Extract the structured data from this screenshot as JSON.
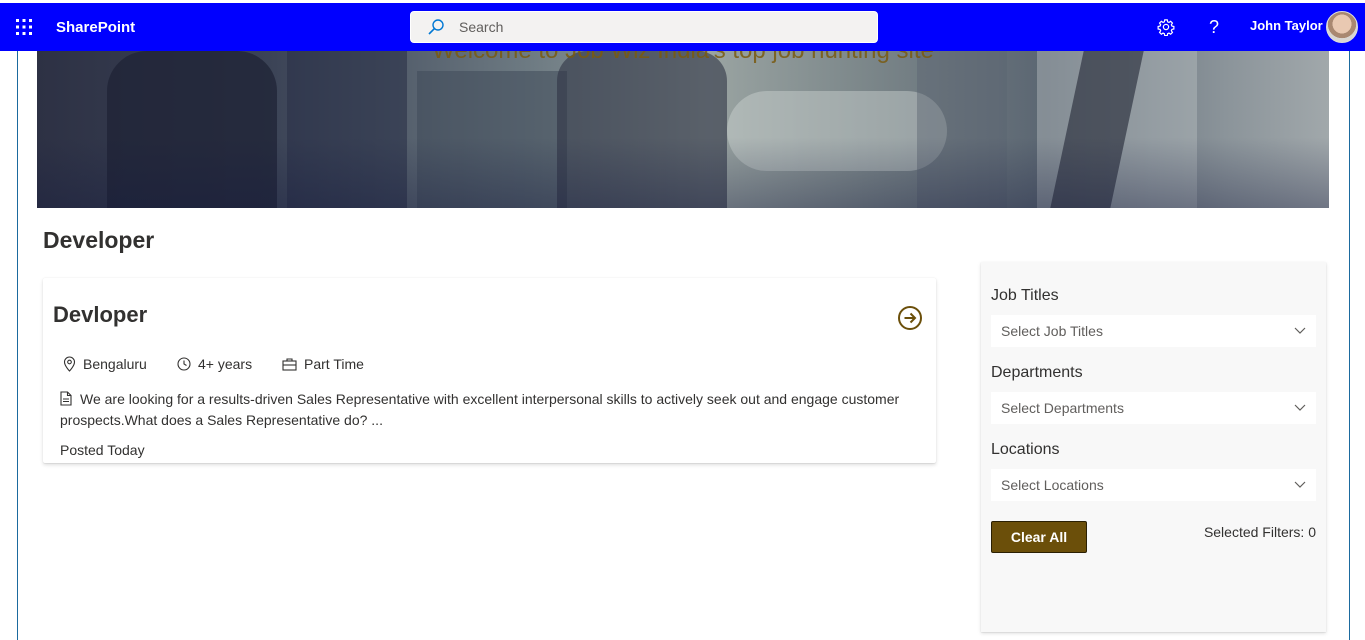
{
  "suitebar": {
    "app_name": "SharePoint",
    "search_placeholder": "Search",
    "help_label": "?",
    "user_name": "John Taylor",
    "background_color": "#0000ff"
  },
  "hero": {
    "text": "Welcome to Job Wiz India's top job hunting site"
  },
  "page": {
    "title": "Developer"
  },
  "job_card": {
    "title": "Devloper",
    "location": "Bengaluru",
    "experience": "4+ years",
    "job_type": "Part Time",
    "description": "We are looking for a results-driven Sales Representative with excellent interpersonal skills to actively seek out and engage customer prospects.What does a Sales Representative do? ...",
    "posted": "Posted Today",
    "accent_color": "#6b4f0a"
  },
  "filters": {
    "job_titles_label": "Job Titles",
    "job_titles_placeholder": "Select Job Titles",
    "departments_label": "Departments",
    "departments_placeholder": "Select Departments",
    "locations_label": "Locations",
    "locations_placeholder": "Select Locations",
    "clear_label": "Clear All",
    "selected_label": "Selected Filters: 0"
  }
}
